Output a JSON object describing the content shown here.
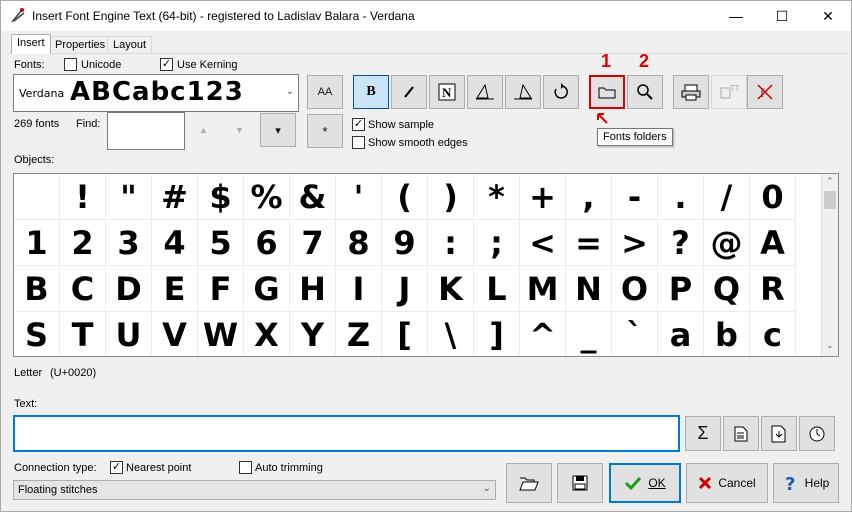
{
  "window": {
    "title": "Insert Font Engine Text (64-bit) - registered to Ladislav Balara - Verdana",
    "minimize": "—",
    "maximize": "☐",
    "close": "✕"
  },
  "tabs": [
    {
      "label": "Insert",
      "active": true
    },
    {
      "label": "Properties",
      "active": false
    },
    {
      "label": "Layout",
      "active": false
    }
  ],
  "fonts": {
    "label": "Fonts:",
    "unicode_label": "Unicode",
    "unicode_checked": false,
    "kerning_label": "Use Kerning",
    "kerning_checked": true,
    "selected_font": "Verdana",
    "sample": "ABCabc123",
    "count": "269 fonts",
    "find_label": "Find:",
    "find_value": ""
  },
  "options": {
    "show_sample_label": "Show sample",
    "show_sample_checked": true,
    "smooth_edges_label": "Show smooth edges",
    "smooth_edges_checked": false
  },
  "toolbar": {
    "aa": "AA",
    "bold": "B",
    "asterisk": "*",
    "up_arrow": "▲",
    "down_arrow": "▼",
    "dropdown": "▾"
  },
  "annotations": {
    "one": "1",
    "two": "2",
    "tooltip": "Fonts folders"
  },
  "objects": {
    "label": "Objects:",
    "glyphs": [
      " ",
      "!",
      "\"",
      "#",
      "$",
      "%",
      "&",
      "'",
      "(",
      ")",
      "*",
      "+",
      ",",
      "-",
      ".",
      "/",
      "0",
      "1",
      "2",
      "3",
      "4",
      "5",
      "6",
      "7",
      "8",
      "9",
      ":",
      ";",
      "<",
      "=",
      ">",
      "?",
      "@",
      "A",
      "B",
      "C",
      "D",
      "E",
      "F",
      "G",
      "H",
      "I",
      "J",
      "K",
      "L",
      "M",
      "N",
      "O",
      "P",
      "Q",
      "R",
      "S",
      "T",
      "U",
      "V",
      "W",
      "X",
      "Y",
      "Z",
      "[",
      "\\",
      "]",
      "^",
      "_",
      "`",
      "a",
      "b",
      "c"
    ],
    "status_name": "Letter",
    "status_code": "(U+0020)"
  },
  "text": {
    "label": "Text:",
    "value": ""
  },
  "connection": {
    "label": "Connection type:",
    "nearest_label": "Nearest point",
    "nearest_checked": true,
    "auto_trim_label": "Auto trimming",
    "auto_trim_checked": false,
    "selected": "Floating stitches"
  },
  "actions": {
    "ok": "OK",
    "cancel": "Cancel",
    "help": "Help"
  }
}
